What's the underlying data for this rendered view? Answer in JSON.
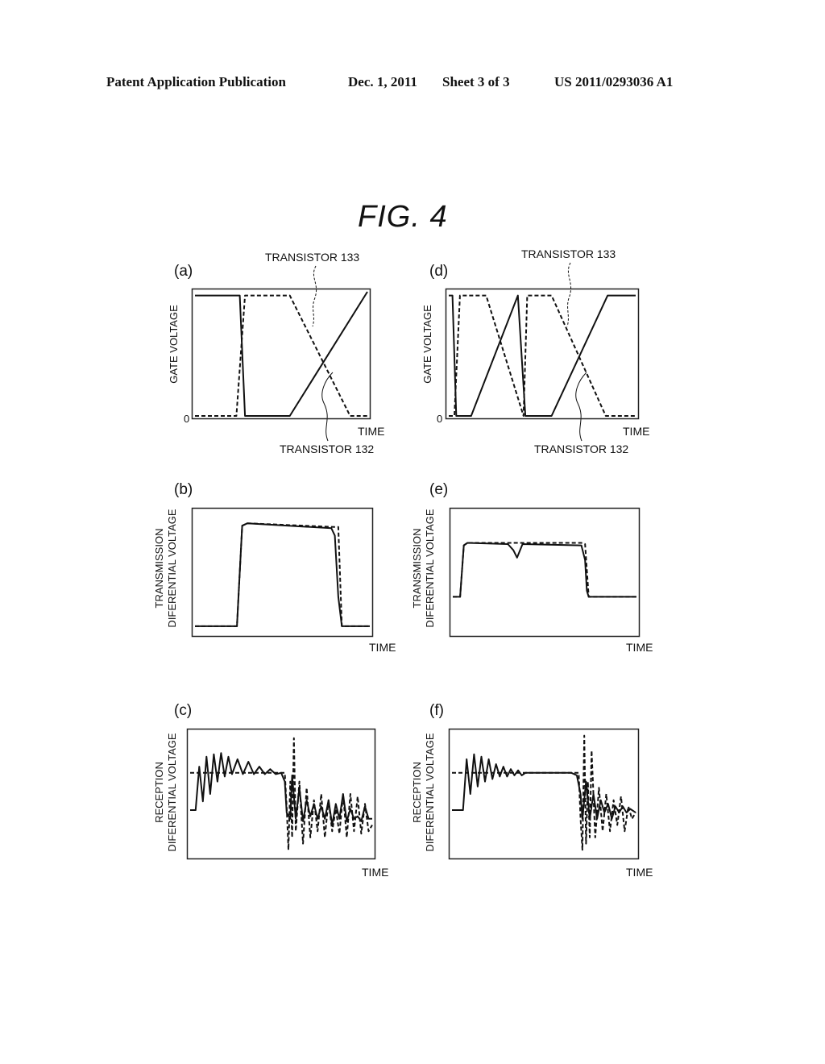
{
  "header": {
    "publication": "Patent Application Publication",
    "date": "Dec. 1, 2011",
    "sheet": "Sheet 3 of 3",
    "number": "US 2011/0293036 A1"
  },
  "figure": {
    "title": "FIG.  4"
  },
  "chart_data": [
    {
      "id": "a",
      "panel_label": "(a)",
      "type": "line",
      "xlabel": "TIME",
      "ylabel": "GATE VOLTAGE",
      "y_tick": "0",
      "annotations": [
        "TRANSISTOR 133",
        "TRANSISTOR 132"
      ],
      "xlim": [
        0,
        1
      ],
      "ylim": [
        0,
        1
      ],
      "series": [
        {
          "name": "TRANSISTOR 132",
          "style": "solid",
          "x": [
            0,
            0.26,
            0.29,
            0.55,
            1.0
          ],
          "y": [
            0.97,
            0.97,
            0.0,
            0.0,
            1.0
          ]
        },
        {
          "name": "TRANSISTOR 133",
          "style": "dashed",
          "x": [
            0,
            0.24,
            0.29,
            0.55,
            0.9,
            1.0
          ],
          "y": [
            0.0,
            0.0,
            0.97,
            0.97,
            0.0,
            0.0
          ]
        }
      ]
    },
    {
      "id": "b",
      "panel_label": "(b)",
      "type": "line",
      "xlabel": "TIME",
      "ylabel": "TRANSMISSION\nDIFERENTIAL VOLTAGE",
      "xlim": [
        0,
        1
      ],
      "ylim": [
        0,
        1
      ],
      "series": [
        {
          "name": "solid",
          "style": "solid",
          "x": [
            0,
            0.24,
            0.27,
            0.3,
            0.78,
            0.8,
            0.82,
            0.84,
            1.0
          ],
          "y": [
            0.06,
            0.06,
            0.88,
            0.9,
            0.86,
            0.8,
            0.3,
            0.06,
            0.06
          ]
        },
        {
          "name": "dashed",
          "style": "dashed",
          "x": [
            0,
            0.24,
            0.27,
            0.3,
            0.8,
            0.82,
            0.84,
            1.0
          ],
          "y": [
            0.06,
            0.06,
            0.88,
            0.9,
            0.87,
            0.87,
            0.06,
            0.06
          ]
        }
      ]
    },
    {
      "id": "c",
      "panel_label": "(c)",
      "type": "line",
      "xlabel": "TIME",
      "ylabel": "RECEPTION\nDIFERENTIAL VOLTAGE",
      "xlim": [
        0,
        1
      ],
      "ylim": [
        0,
        1
      ],
      "series": [
        {
          "name": "solid",
          "style": "solid",
          "x": [
            0,
            0.03,
            0.05,
            0.07,
            0.09,
            0.11,
            0.13,
            0.15,
            0.17,
            0.19,
            0.21,
            0.23,
            0.26,
            0.29,
            0.32,
            0.35,
            0.38,
            0.41,
            0.44,
            0.47,
            0.5,
            0.52,
            0.53,
            0.55,
            0.56,
            0.58,
            0.6,
            0.62,
            0.64,
            0.66,
            0.68,
            0.7,
            0.72,
            0.74,
            0.76,
            0.78,
            0.8,
            0.82,
            0.84,
            0.86,
            0.88,
            0.9,
            0.92,
            0.94,
            0.96,
            0.98,
            1.0
          ],
          "y": [
            0.37,
            0.37,
            0.72,
            0.44,
            0.8,
            0.5,
            0.82,
            0.6,
            0.83,
            0.64,
            0.8,
            0.66,
            0.78,
            0.66,
            0.76,
            0.66,
            0.72,
            0.66,
            0.7,
            0.66,
            0.67,
            0.6,
            0.35,
            0.3,
            0.65,
            0.3,
            0.55,
            0.28,
            0.45,
            0.32,
            0.42,
            0.3,
            0.4,
            0.3,
            0.45,
            0.25,
            0.42,
            0.3,
            0.5,
            0.28,
            0.38,
            0.3,
            0.32,
            0.28,
            0.4,
            0.3,
            0.3
          ]
        },
        {
          "name": "dashed",
          "style": "dashed",
          "x": [
            0,
            0.52,
            0.53,
            0.54,
            0.55,
            0.56,
            0.57,
            0.58,
            0.6,
            0.62,
            0.64,
            0.66,
            0.68,
            0.7,
            0.72,
            0.74,
            0.76,
            0.78,
            0.8,
            0.82,
            0.84,
            0.86,
            0.88,
            0.9,
            0.92,
            0.94,
            0.96,
            0.98,
            1.0
          ],
          "y": [
            0.67,
            0.67,
            0.4,
            0.05,
            0.6,
            0.15,
            0.95,
            0.2,
            0.6,
            0.1,
            0.55,
            0.15,
            0.45,
            0.2,
            0.5,
            0.15,
            0.45,
            0.2,
            0.38,
            0.18,
            0.5,
            0.15,
            0.5,
            0.2,
            0.48,
            0.18,
            0.42,
            0.2,
            0.25
          ]
        }
      ]
    },
    {
      "id": "d",
      "panel_label": "(d)",
      "type": "line",
      "xlabel": "TIME",
      "ylabel": "GATE VOLTAGE",
      "y_tick": "0",
      "annotations": [
        "TRANSISTOR 133",
        "TRANSISTOR 132"
      ],
      "xlim": [
        0,
        1
      ],
      "ylim": [
        0,
        1
      ],
      "series": [
        {
          "name": "TRANSISTOR 132",
          "style": "solid",
          "x": [
            0,
            0.02,
            0.04,
            0.12,
            0.37,
            0.41,
            0.55,
            0.85,
            1.0
          ],
          "y": [
            0.97,
            0.97,
            0.0,
            0.0,
            0.97,
            0.0,
            0.0,
            0.97,
            0.97
          ]
        },
        {
          "name": "TRANSISTOR 133",
          "style": "dashed",
          "x": [
            0,
            0.03,
            0.06,
            0.2,
            0.4,
            0.42,
            0.55,
            0.84,
            1.0
          ],
          "y": [
            0.0,
            0.0,
            0.97,
            0.97,
            0.0,
            0.97,
            0.97,
            0.0,
            0.0
          ]
        }
      ]
    },
    {
      "id": "e",
      "panel_label": "(e)",
      "type": "line",
      "xlabel": "TIME",
      "ylabel": "TRANSMISSION\nDIFERENTIAL VOLTAGE",
      "xlim": [
        0,
        1
      ],
      "ylim": [
        0,
        1
      ],
      "series": [
        {
          "name": "solid",
          "style": "solid",
          "x": [
            0,
            0.04,
            0.06,
            0.08,
            0.3,
            0.33,
            0.35,
            0.38,
            0.7,
            0.72,
            0.73,
            0.74,
            1.0
          ],
          "y": [
            0.3,
            0.3,
            0.72,
            0.74,
            0.73,
            0.68,
            0.62,
            0.73,
            0.72,
            0.6,
            0.35,
            0.3,
            0.3
          ]
        },
        {
          "name": "dashed",
          "style": "dashed",
          "x": [
            0,
            0.04,
            0.06,
            0.08,
            0.7,
            0.72,
            0.74,
            1.0
          ],
          "y": [
            0.3,
            0.3,
            0.72,
            0.74,
            0.74,
            0.73,
            0.3,
            0.3
          ]
        }
      ]
    },
    {
      "id": "f",
      "panel_label": "(f)",
      "type": "line",
      "xlabel": "TIME",
      "ylabel": "RECEPTION\nDIFERENTIAL VOLTAGE",
      "xlim": [
        0,
        1
      ],
      "ylim": [
        0,
        1
      ],
      "series": [
        {
          "name": "solid",
          "style": "solid",
          "x": [
            0,
            0.06,
            0.08,
            0.1,
            0.12,
            0.14,
            0.16,
            0.18,
            0.2,
            0.22,
            0.24,
            0.26,
            0.28,
            0.3,
            0.32,
            0.34,
            0.36,
            0.38,
            0.4,
            0.65,
            0.68,
            0.7,
            0.71,
            0.73,
            0.75,
            0.77,
            0.79,
            0.81,
            0.83,
            0.85,
            0.87,
            0.89,
            0.91,
            0.93,
            0.95,
            0.97,
            1.0
          ],
          "y": [
            0.37,
            0.37,
            0.78,
            0.5,
            0.82,
            0.56,
            0.8,
            0.6,
            0.78,
            0.62,
            0.74,
            0.64,
            0.72,
            0.64,
            0.7,
            0.65,
            0.69,
            0.65,
            0.67,
            0.67,
            0.65,
            0.5,
            0.3,
            0.6,
            0.3,
            0.5,
            0.3,
            0.45,
            0.35,
            0.42,
            0.3,
            0.4,
            0.35,
            0.4,
            0.35,
            0.38,
            0.35
          ]
        },
        {
          "name": "dashed",
          "style": "dashed",
          "x": [
            0,
            0.69,
            0.7,
            0.71,
            0.72,
            0.73,
            0.74,
            0.75,
            0.76,
            0.78,
            0.8,
            0.82,
            0.84,
            0.86,
            0.88,
            0.9,
            0.92,
            0.94,
            0.96,
            0.98,
            1.0
          ],
          "y": [
            0.67,
            0.67,
            0.3,
            0.05,
            0.97,
            0.1,
            0.6,
            0.15,
            0.85,
            0.15,
            0.55,
            0.2,
            0.5,
            0.2,
            0.45,
            0.25,
            0.48,
            0.2,
            0.4,
            0.3,
            0.35
          ]
        }
      ]
    }
  ]
}
